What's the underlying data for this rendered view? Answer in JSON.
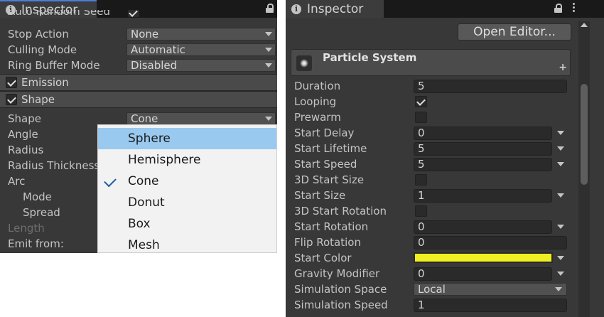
{
  "left": {
    "tab_title": "Inspector",
    "clipped_label": "Auto Random Seed",
    "rows": [
      {
        "label": "Stop Action",
        "value": "None"
      },
      {
        "label": "Culling Mode",
        "value": "Automatic"
      },
      {
        "label": "Ring Buffer Mode",
        "value": "Disabled"
      }
    ],
    "sections": {
      "emission": "Emission",
      "shape": "Shape"
    },
    "shape_row": {
      "label": "Shape",
      "value": "Cone"
    },
    "labels": [
      "Angle",
      "Radius",
      "Radius Thickness",
      "Arc",
      "Mode",
      "Spread",
      "Length",
      "Emit from:"
    ],
    "menu": {
      "items": [
        "Sphere",
        "Hemisphere",
        "Cone",
        "Donut",
        "Box",
        "Mesh"
      ],
      "hovered": "Sphere",
      "checked": "Cone"
    }
  },
  "right": {
    "tab_title": "Inspector",
    "open_editor": "Open Editor...",
    "component": "Particle System",
    "add_symbol": "+",
    "rows": [
      {
        "label": "Duration",
        "kind": "field",
        "value": "5"
      },
      {
        "label": "Looping",
        "kind": "check",
        "checked": true
      },
      {
        "label": "Prewarm",
        "kind": "check",
        "checked": false
      },
      {
        "label": "Start Delay",
        "kind": "curve",
        "value": "0"
      },
      {
        "label": "Start Lifetime",
        "kind": "curve",
        "value": "5"
      },
      {
        "label": "Start Speed",
        "kind": "curve",
        "value": "5"
      },
      {
        "label": "3D Start Size",
        "kind": "check",
        "checked": false
      },
      {
        "label": "Start Size",
        "kind": "curve",
        "value": "1"
      },
      {
        "label": "3D Start Rotation",
        "kind": "check",
        "checked": false
      },
      {
        "label": "Start Rotation",
        "kind": "curve",
        "value": "0"
      },
      {
        "label": "Flip Rotation",
        "kind": "field",
        "value": "0"
      },
      {
        "label": "Start Color",
        "kind": "color",
        "color": "#f0f020"
      },
      {
        "label": "Gravity Modifier",
        "kind": "curve",
        "value": "0"
      },
      {
        "label": "Simulation Space",
        "kind": "dropdown",
        "value": "Local"
      },
      {
        "label": "Simulation Speed",
        "kind": "field",
        "value": "1"
      }
    ]
  }
}
